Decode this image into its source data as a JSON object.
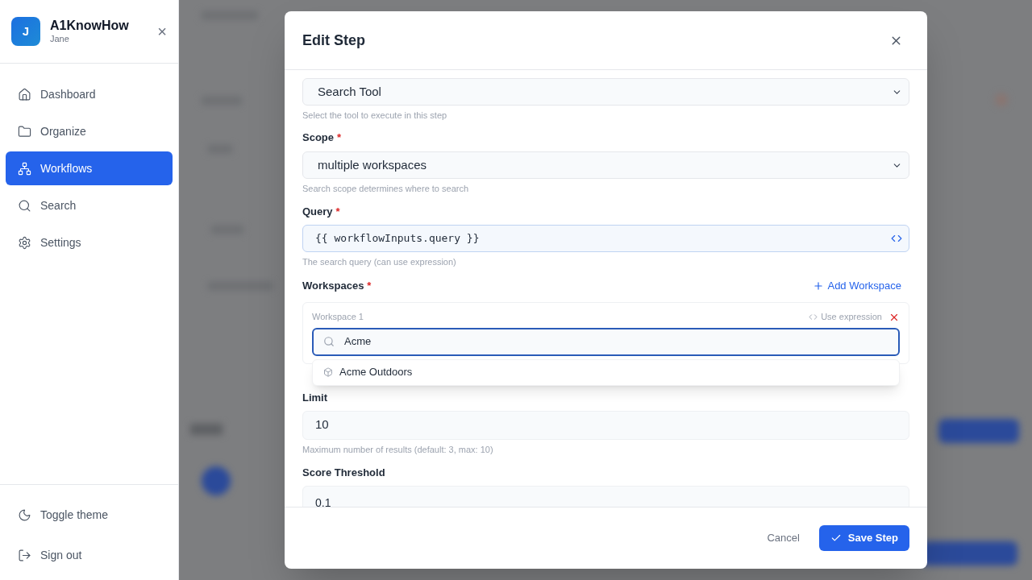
{
  "sidebar": {
    "avatar": "J",
    "app_name": "A1KnowHow",
    "user": "Jane",
    "close": "×",
    "items": [
      {
        "label": "Dashboard",
        "selected": false
      },
      {
        "label": "Organize",
        "selected": false
      },
      {
        "label": "Workflows",
        "selected": true
      },
      {
        "label": "Search",
        "selected": false
      },
      {
        "label": "Settings",
        "selected": false
      }
    ],
    "footer_items": [
      {
        "label": "Toggle theme"
      },
      {
        "label": "Sign out"
      }
    ]
  },
  "dialog": {
    "title": "Edit Step",
    "tool": {
      "value": "Search Tool",
      "help": "Select the tool to execute in this step"
    },
    "scope": {
      "label": "Scope",
      "required_mark": "*",
      "value": "multiple workspaces",
      "help": "Search scope determines where to search"
    },
    "query": {
      "label": "Query",
      "required_mark": "*",
      "value": "{{ workflowInputs.query }}",
      "help": "The search query (can use expression)"
    },
    "workspaces": {
      "label": "Workspaces",
      "required_mark": "*",
      "add": "Add Workspace",
      "items": [
        {
          "label": "Workspace 1",
          "use_expression": "Use expression",
          "search": "Acme",
          "focused": true,
          "results": [
            {
              "label": "Acme Outdoors"
            }
          ]
        }
      ]
    },
    "limit": {
      "label": "Limit",
      "value": "10",
      "help": "Maximum number of results (default: 3, max: 10)"
    },
    "threshold": {
      "label": "Score Threshold",
      "value": "0.1"
    },
    "buttons": {
      "cancel": "Cancel",
      "save": "Save Step"
    }
  }
}
